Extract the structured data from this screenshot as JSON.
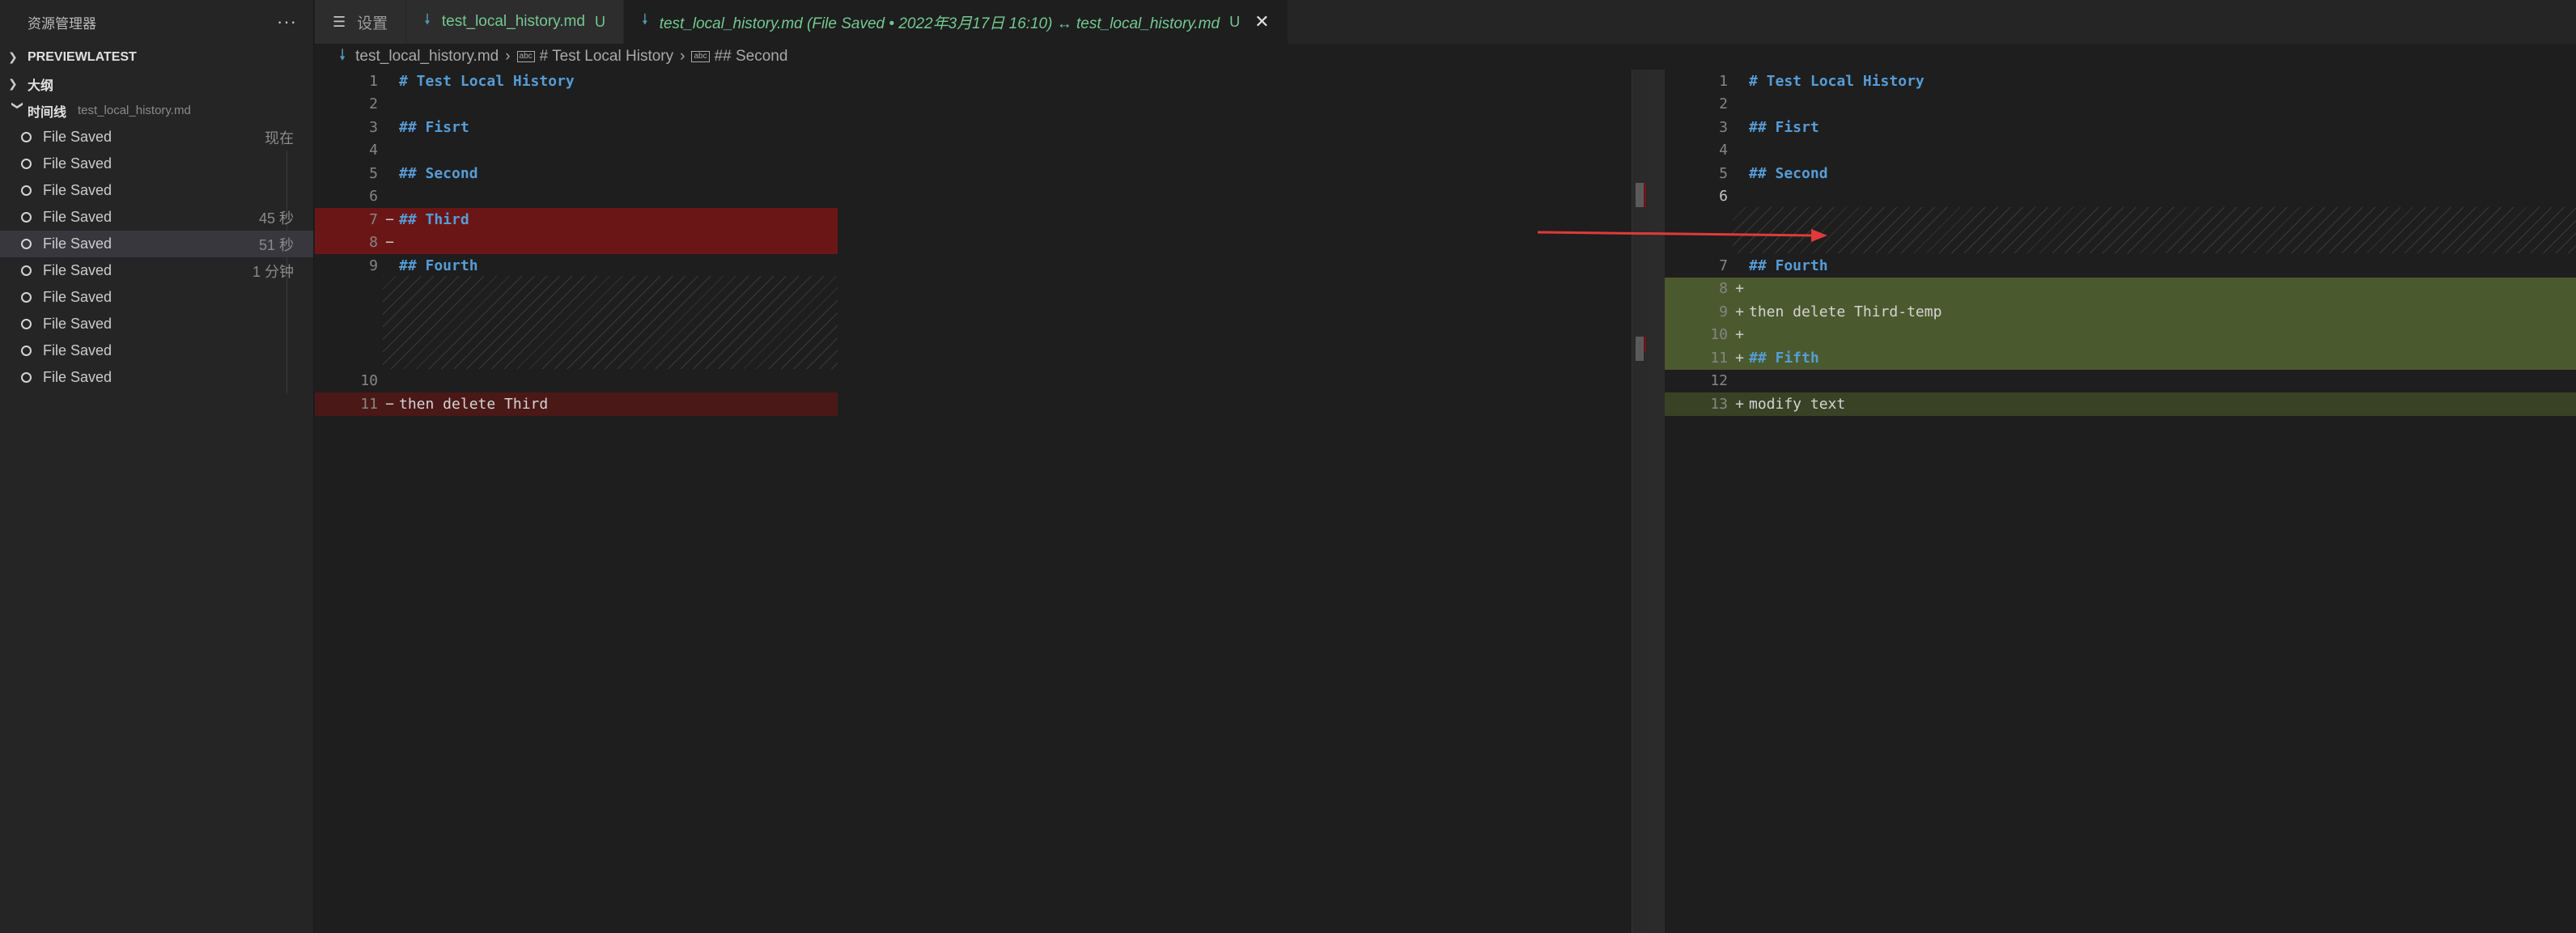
{
  "sidebar": {
    "title": "资源管理器",
    "more_label": "···",
    "sections": [
      {
        "label": "PREVIEWLATEST",
        "expanded": false
      },
      {
        "label": "大纲",
        "expanded": false
      },
      {
        "label": "时间线",
        "expanded": true,
        "description": "test_local_history.md"
      }
    ],
    "timeline": [
      {
        "label": "File Saved",
        "time": "现在"
      },
      {
        "label": "File Saved",
        "time": ""
      },
      {
        "label": "File Saved",
        "time": ""
      },
      {
        "label": "File Saved",
        "time": "45 秒"
      },
      {
        "label": "File Saved",
        "time": "51 秒",
        "selected": true
      },
      {
        "label": "File Saved",
        "time": "1 分钟"
      },
      {
        "label": "File Saved",
        "time": ""
      },
      {
        "label": "File Saved",
        "time": ""
      },
      {
        "label": "File Saved",
        "time": ""
      },
      {
        "label": "File Saved",
        "time": ""
      }
    ]
  },
  "tabs": [
    {
      "icon": "gear-icon",
      "label": "设置",
      "badge": ""
    },
    {
      "icon": "markdown-icon",
      "label": "test_local_history.md",
      "badge": "U"
    },
    {
      "icon": "markdown-icon",
      "label": "test_local_history.md (File Saved • 2022年3月17日 16:10) ↔ test_local_history.md",
      "badge": "U",
      "active": true,
      "close": "✕"
    }
  ],
  "breadcrumb": {
    "file": "test_local_history.md",
    "items": [
      "# Test Local History",
      "## Second"
    ]
  },
  "left_editor": {
    "lines": [
      {
        "num": "1",
        "text": "# Test Local History",
        "kind": "hdr"
      },
      {
        "num": "2",
        "text": "",
        "kind": "txt"
      },
      {
        "num": "3",
        "text": "## Fisrt",
        "kind": "hdr"
      },
      {
        "num": "4",
        "text": "",
        "kind": "txt"
      },
      {
        "num": "5",
        "text": "## Second",
        "kind": "hdr"
      },
      {
        "num": "6",
        "text": "",
        "kind": "txt"
      },
      {
        "num": "7",
        "text": "## Third",
        "kind": "hdr",
        "diff": "del",
        "mark": "−"
      },
      {
        "num": "8",
        "text": "",
        "kind": "txt",
        "diff": "del",
        "mark": "−"
      },
      {
        "num": "9",
        "text": "## Fourth",
        "kind": "hdr"
      },
      {
        "num": "10",
        "text": "",
        "kind": "txt"
      },
      {
        "num": "11",
        "text": "then delete Third",
        "kind": "txt",
        "diff": "del-light",
        "mark": "−"
      }
    ]
  },
  "right_editor": {
    "lines": [
      {
        "num": "1",
        "text": "# Test Local History",
        "kind": "hdr"
      },
      {
        "num": "2",
        "text": "",
        "kind": "txt"
      },
      {
        "num": "3",
        "text": "## Fisrt",
        "kind": "hdr"
      },
      {
        "num": "4",
        "text": "",
        "kind": "txt"
      },
      {
        "num": "5",
        "text": "## Second",
        "kind": "hdr"
      },
      {
        "num": "6",
        "text": "",
        "kind": "txt",
        "current": true
      },
      {
        "num": "7",
        "text": "## Fourth",
        "kind": "hdr"
      },
      {
        "num": "8",
        "text": "",
        "kind": "txt",
        "diff": "add",
        "mark": "+"
      },
      {
        "num": "9",
        "text": "then delete Third-temp",
        "kind": "txt",
        "diff": "add",
        "mark": "+"
      },
      {
        "num": "10",
        "text": "",
        "kind": "txt",
        "diff": "add",
        "mark": "+"
      },
      {
        "num": "11",
        "text": "## Fifth",
        "kind": "hdr",
        "diff": "add",
        "mark": "+"
      },
      {
        "num": "12",
        "text": "",
        "kind": "txt"
      },
      {
        "num": "13",
        "text": "modify text",
        "kind": "txt",
        "diff": "add-light",
        "mark": "+"
      }
    ]
  },
  "colors": {
    "deleted": "#6b1616",
    "inserted": "#4b5a2e",
    "heading": "#569cd6",
    "arrow": "#e03a3a"
  }
}
